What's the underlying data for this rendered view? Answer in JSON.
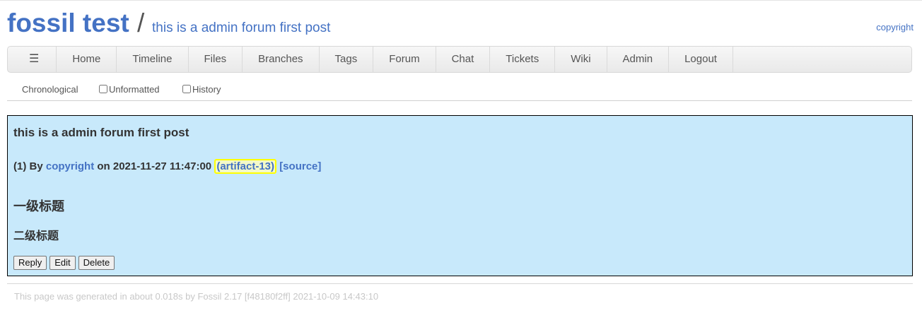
{
  "header": {
    "project_name": "fossil test",
    "separator": "/",
    "page_title": "this is a admin forum first post",
    "login_user": "copyright"
  },
  "menu": {
    "hamburger_icon": "☰",
    "items": [
      "Home",
      "Timeline",
      "Files",
      "Branches",
      "Tags",
      "Forum",
      "Chat",
      "Tickets",
      "Wiki",
      "Admin",
      "Logout"
    ]
  },
  "submenu": {
    "chronological": "Chronological",
    "unformatted": "Unformatted",
    "history": "History",
    "unformatted_checked": false,
    "history_checked": false
  },
  "post": {
    "title": "this is a admin forum first post",
    "number": "(1) By",
    "author": "copyright",
    "date_text": "on 2021-11-27 11:47:00",
    "artifact": "(artifact-13)",
    "source": "[source]",
    "heading1": "一级标题",
    "heading2": "二级标题",
    "buttons": {
      "reply": "Reply",
      "edit": "Edit",
      "delete": "Delete"
    },
    "background_color": "#c8e9fb",
    "highlight_color": "#ffff00"
  },
  "footer": {
    "text": "This page was generated in about 0.018s by Fossil 2.17 [f48180f2ff] 2021-10-09 14:43:10"
  },
  "colors": {
    "link": "#4472c4"
  }
}
